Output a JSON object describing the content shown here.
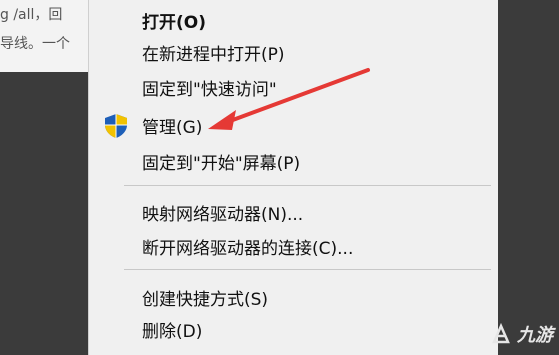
{
  "background_doc": {
    "line1": "g /all，回",
    "line2": "导线。一个"
  },
  "context_menu": {
    "items": [
      {
        "label": "打开(O)",
        "bold": true
      },
      {
        "label": "在新进程中打开(P)"
      },
      {
        "label": "固定到\"快速访问\""
      },
      {
        "label": "管理(G)",
        "icon": "uac-shield-icon"
      },
      {
        "label": "固定到\"开始\"屏幕(P)"
      },
      {
        "label": "映射网络驱动器(N)..."
      },
      {
        "label": "断开网络驱动器的连接(C)..."
      },
      {
        "label": "创建快捷方式(S)"
      },
      {
        "label": "删除(D)"
      }
    ]
  },
  "annotation": {
    "type": "red-arrow",
    "points_to": "管理(G)",
    "color": "#e53935"
  },
  "watermark": {
    "text": "九游"
  }
}
